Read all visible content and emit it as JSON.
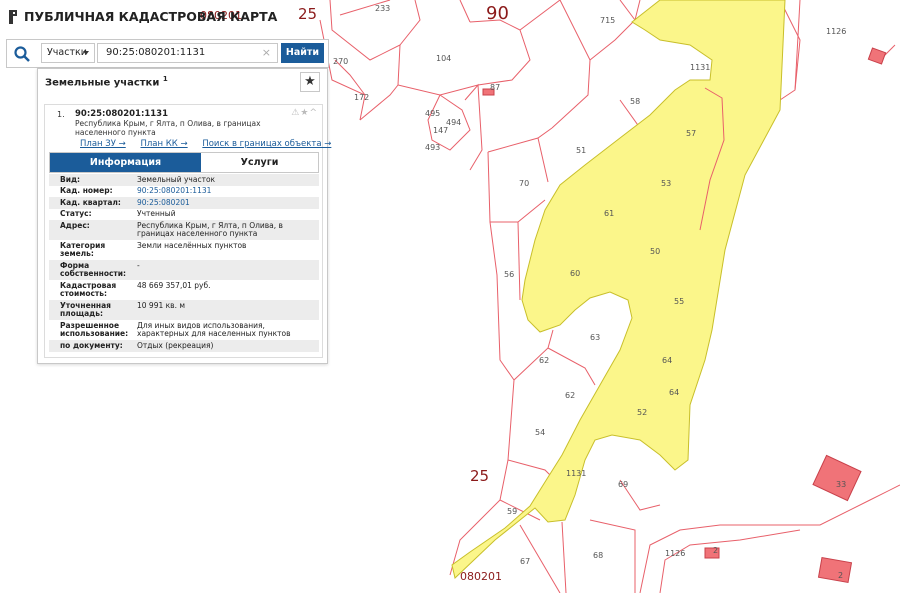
{
  "header": {
    "title": "ПУБЛИЧНАЯ КАДАСТРОВАЯ КАРТА"
  },
  "search": {
    "type_label": "Участки",
    "query": "90:25:080201:1131",
    "find_label": "Найти"
  },
  "panel": {
    "title": "Земельные участки",
    "count": "1",
    "item": {
      "index": "1.",
      "cad_number": "90:25:080201:1131",
      "address": "Республика Крым, г Ялта, п Олива, в границах населенного пункта",
      "links": [
        "План ЗУ →",
        "План КК →",
        "Поиск в границах объекта →"
      ],
      "tabs": [
        "Информация",
        "Услуги"
      ],
      "rows": [
        {
          "k": "Вид:",
          "v": "Земельный участок"
        },
        {
          "k": "Кад. номер:",
          "v": "90:25:080201:1131"
        },
        {
          "k": "Кад. квартал:",
          "v": "90:25:080201"
        },
        {
          "k": "Статус:",
          "v": "Учтенный"
        },
        {
          "k": "Адрес:",
          "v": "Республика Крым, г Ялта, п Олива, в границах населенного пункта"
        },
        {
          "k": "Категория земель:",
          "v": "Земли населённых пунктов"
        },
        {
          "k": "Форма собственности:",
          "v": "-"
        },
        {
          "k": "Кадастровая стоимость:",
          "v": "48 669 357,01 руб."
        },
        {
          "k": "Уточненная площадь:",
          "v": "10 991 кв. м"
        },
        {
          "k": "Разрешенное использование:",
          "v": "Для иных видов использования, характерных для населенных пунктов"
        },
        {
          "k": "по документу:",
          "v": "Отдых (рекреация)"
        }
      ]
    }
  },
  "map": {
    "big_labels": [
      "25",
      "90",
      "25"
    ],
    "quarter_labels": [
      "080201",
      "080201"
    ],
    "parcel_labels": [
      "233",
      "715",
      "1126",
      "1131",
      "270",
      "104",
      "87",
      "172",
      "58",
      "57",
      "495",
      "494",
      "147",
      "493",
      "51",
      "53",
      "70",
      "61",
      "50",
      "56",
      "60",
      "55",
      "63",
      "62",
      "64",
      "62",
      "64",
      "52",
      "54",
      "1131",
      "69",
      "59",
      "67",
      "68",
      "1126",
      "2",
      "33",
      "2"
    ],
    "colors": {
      "parcel_stroke": "#e8606a",
      "highlight_fill": "#fbf68a",
      "highlight_stroke": "#c8bf2a",
      "red_building": "#f07378",
      "search_button": "#1b5c9a"
    }
  }
}
